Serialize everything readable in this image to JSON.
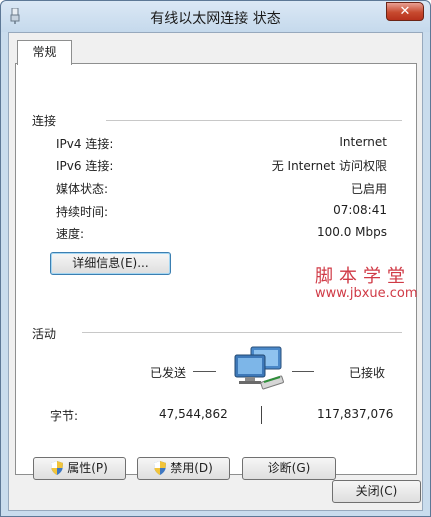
{
  "window": {
    "title": "有线以太网连接 状态",
    "close_glyph": "✕"
  },
  "tabs": [
    {
      "label": "常规",
      "selected": true
    }
  ],
  "connection": {
    "section_label": "连接",
    "rows": [
      {
        "label": "IPv4 连接:",
        "value": "Internet"
      },
      {
        "label": "IPv6 连接:",
        "value": "无 Internet 访问权限"
      },
      {
        "label": "媒体状态:",
        "value": "已启用"
      },
      {
        "label": "持续时间:",
        "value": "07:08:41"
      },
      {
        "label": "速度:",
        "value": "100.0 Mbps"
      }
    ],
    "details_button": "详细信息(E)..."
  },
  "watermark": {
    "text": "脚本学堂",
    "url": "www.jbxue.com",
    "color": "#d03a46"
  },
  "activity": {
    "section_label": "活动",
    "sent_label": "已发送",
    "received_label": "已接收",
    "bytes_label": "字节:",
    "bytes_sent": "47,544,862",
    "bytes_received": "117,837,076",
    "icon": "network-computers-icon"
  },
  "actions": {
    "properties_button": "属性(P)",
    "disable_button": "禁用(D)",
    "diagnose_button": "诊断(G)",
    "shield_icon": "uac-shield-icon"
  },
  "footer": {
    "close_button": "关闭(C)"
  },
  "colors": {
    "frame": "#c9dced",
    "close_red": "#c74a2f",
    "focus_blue": "#3c7fb1"
  }
}
